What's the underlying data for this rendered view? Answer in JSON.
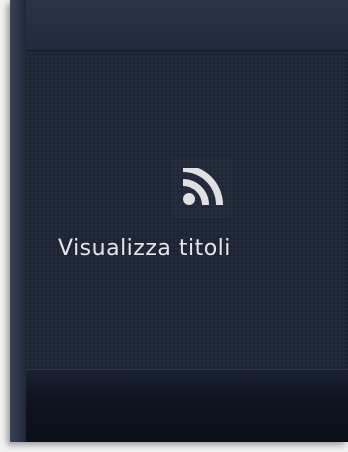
{
  "tile": {
    "icon": "rss-feed-icon",
    "label": "Visualizza titoli"
  },
  "colors": {
    "background": "#1d2535",
    "text": "#e6e6e6",
    "icon": "#e0e0e0"
  }
}
